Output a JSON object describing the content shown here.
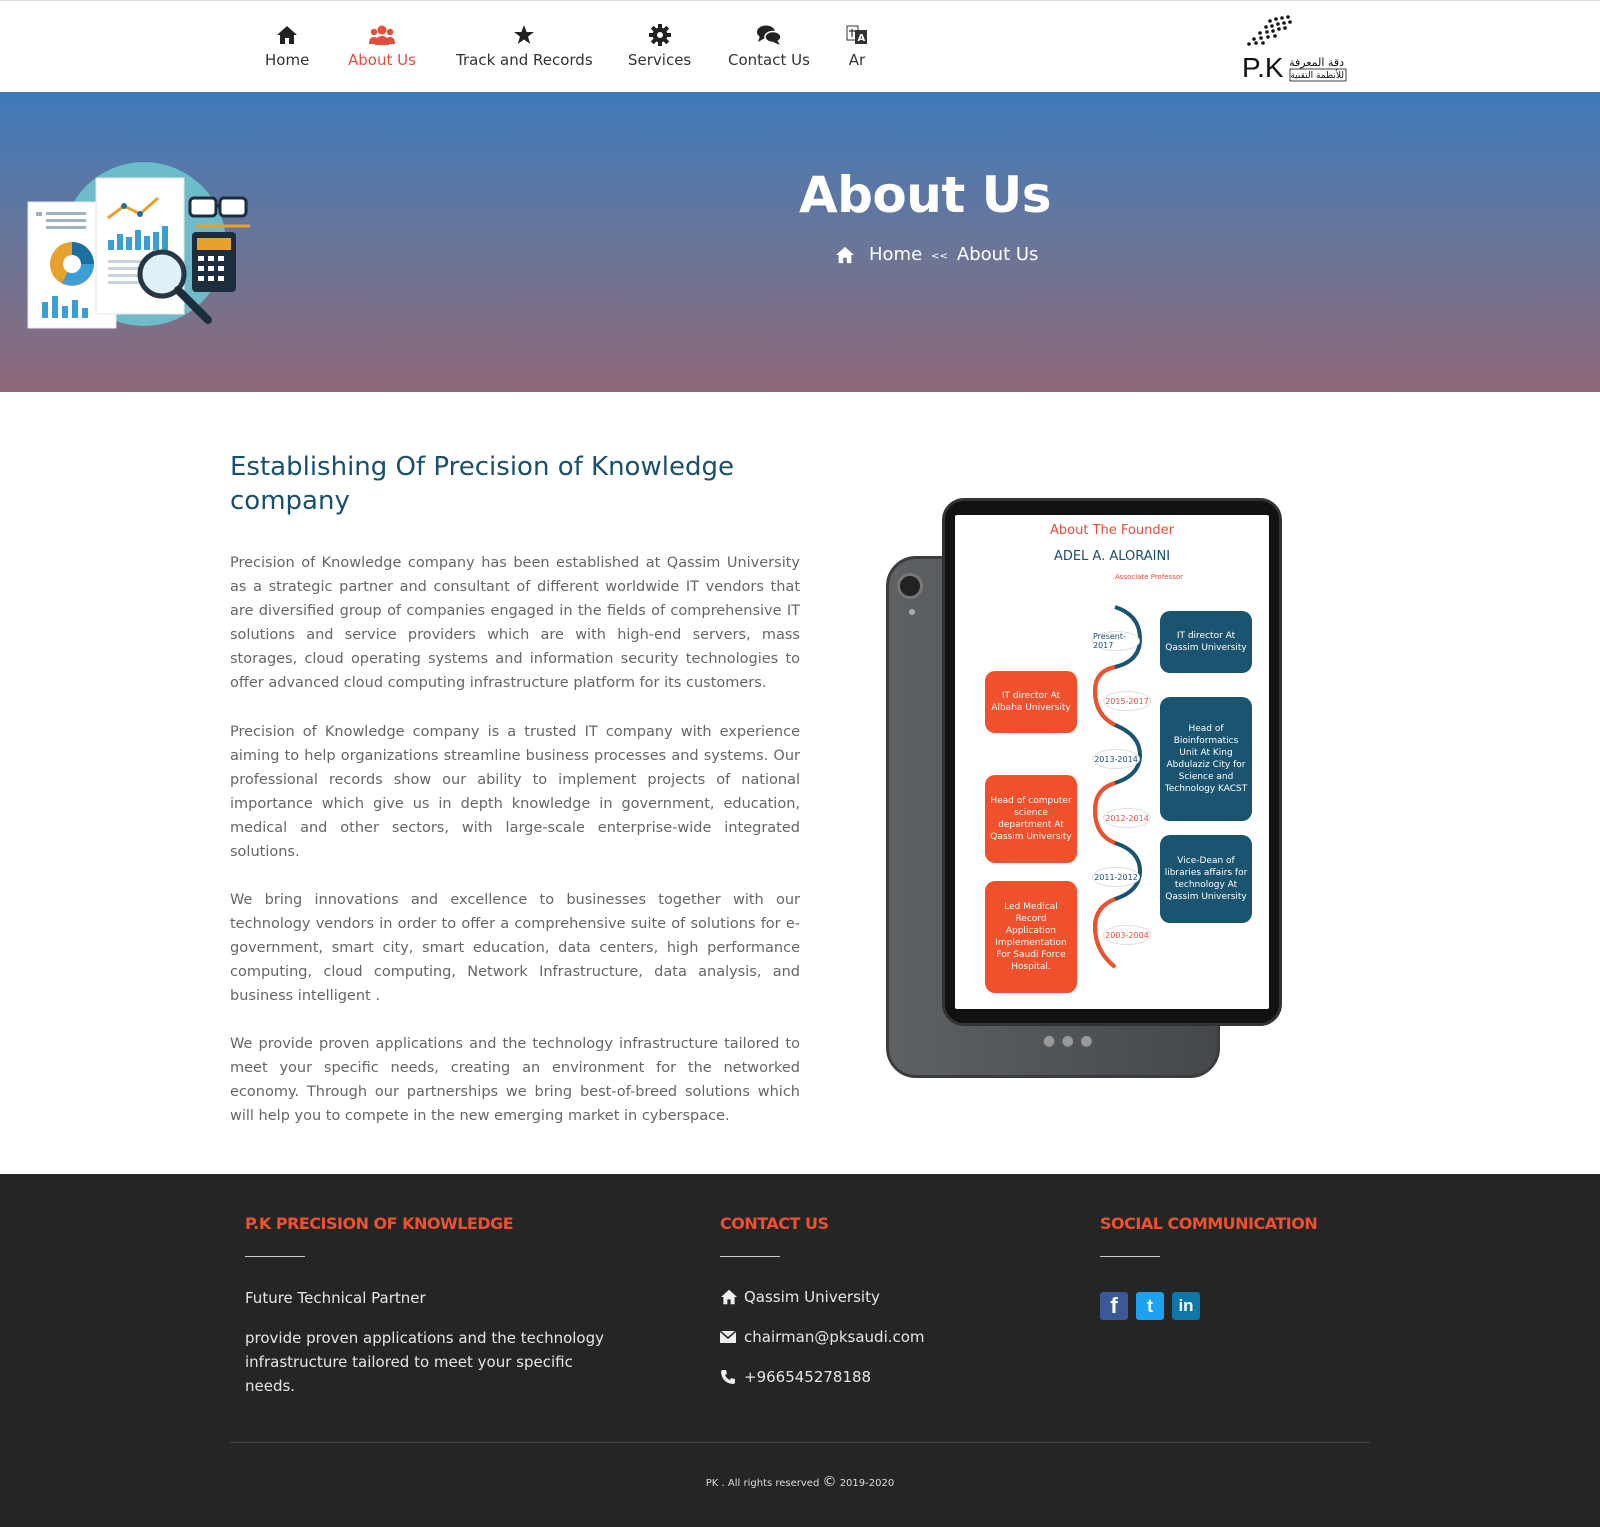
{
  "nav": {
    "items": [
      {
        "label": "Home",
        "icon": "home-icon"
      },
      {
        "label": "About Us",
        "icon": "users-icon",
        "active": true
      },
      {
        "label": "Track and Records",
        "icon": "star-icon"
      },
      {
        "label": "Services",
        "icon": "gear-icon"
      },
      {
        "label": "Contact Us",
        "icon": "chat-icon"
      },
      {
        "label": "Ar",
        "icon": "translate-icon"
      }
    ],
    "active_color": "#e74c3c"
  },
  "logo": {
    "text": "P.K",
    "arabic_1": "دقة المعرفة",
    "arabic_2": "للأنظمة التقنية"
  },
  "hero": {
    "title": "About Us",
    "breadcrumb": {
      "home": "Home",
      "separator": "<<",
      "current": "About Us"
    }
  },
  "main": {
    "title": "Establishing Of Precision of Knowledge company",
    "paragraphs": [
      "Precision of Knowledge company has been established at Qassim University as a strategic partner and consultant of different worldwide IT vendors that are diversified group of companies engaged in the fields of comprehensive IT solutions and service providers which are with high-end servers, mass storages, cloud operating systems and information security technologies to offer advanced cloud computing infrastructure platform for its customers.",
      "Precision of Knowledge company is a trusted IT company with experience aiming to help organizations streamline business processes and systems. Our professional records show our ability to implement projects of national importance which give us in depth knowledge in government, education, medical and other sectors, with large-scale enterprise-wide integrated solutions.",
      "We bring innovations and excellence to businesses together with our technology vendors in order to offer a comprehensive suite of solutions for e-government, smart city, smart education, data centers, high performance computing, cloud computing, Network Infrastructure, data analysis, and business intelligent .",
      "We provide proven applications and the technology infrastructure tailored to meet your specific needs, creating an environment for the networked economy. Through our partnerships we bring best-of-breed solutions which will help you to compete in the new emerging market in cyberspace."
    ]
  },
  "founder": {
    "heading": "About The Founder",
    "name": "ADEL A. ALORAINI",
    "role": "Associate Professor",
    "timeline": {
      "right": [
        {
          "year": "Present-2017",
          "text": "IT director At Qassim University"
        },
        {
          "year": "2013-2014",
          "text": "Head of Bioinformatics Unit At King Abdulaziz City for Science and Technology KACST"
        },
        {
          "year": "2011-2012",
          "text": "Vice-Dean of libraries affairs for technology At Qassim University"
        }
      ],
      "left": [
        {
          "year": "2015-2017",
          "text": "IT director At Albaha University"
        },
        {
          "year": "2012-2014",
          "text": "Head of computer science department At Qassim University"
        },
        {
          "year": "2003-2004",
          "text": "Led Medical Record Application Implementation For Saudi Force Hospital."
        }
      ]
    }
  },
  "footer": {
    "about": {
      "heading": "P.K PRECISION OF KNOWLEDGE",
      "tagline": "Future Technical Partner",
      "text": "provide proven applications and the technology infrastructure tailored to meet your specific needs."
    },
    "contact": {
      "heading": "CONTACT US",
      "address": "Qassim University",
      "email": "chairman@pksaudi.com",
      "phone": "+966545278188"
    },
    "social": {
      "heading": "SOCIAL COMMUNICATION",
      "links": [
        {
          "name": "facebook",
          "glyph": "f",
          "color": "#3b5998"
        },
        {
          "name": "twitter",
          "glyph": "t",
          "color": "#1da1f2"
        },
        {
          "name": "linkedin",
          "glyph": "in",
          "color": "#0e76a8"
        }
      ]
    },
    "copyright": {
      "owner": "PK . All rights reserved",
      "symbol": "©",
      "years": "2019-2020"
    }
  }
}
